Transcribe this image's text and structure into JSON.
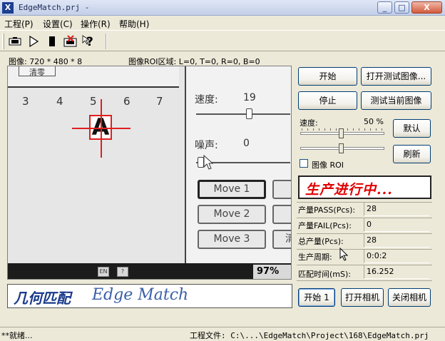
{
  "window": {
    "title": "EdgeMatch.prj -",
    "app_icon": "X",
    "minimize": "_",
    "maximize": "□",
    "close": "X"
  },
  "menu": [
    {
      "label": "工程(P)"
    },
    {
      "label": "设置(C)"
    },
    {
      "label": "操作(R)"
    },
    {
      "label": "帮助(H)"
    }
  ],
  "toolbar": {
    "icons": [
      "camera-icon",
      "play-icon",
      "stop-icon",
      "camera-off-icon",
      "help-icon"
    ]
  },
  "image_info": {
    "size": "图像: 720 * 480 * 8",
    "roi": "图像ROI区域: L=0, T=0, R=0, B=0"
  },
  "view": {
    "tab": "清零",
    "numbers": [
      "3",
      "4",
      "5",
      "6",
      "7"
    ],
    "speed_label": "速度:",
    "speed_value": "19",
    "noise_label": "噪声:",
    "noise_value": "0",
    "move_buttons": [
      "Move 1",
      "Move 2",
      "Move 3"
    ],
    "right_edge_char": "清",
    "bottom_icons": [
      "EN",
      "?"
    ],
    "bottom_right": "97%",
    "target_letter": "A"
  },
  "controls": {
    "start": "开始",
    "open_test_image": "打开测试图像...",
    "stop": "停止",
    "test_current_image": "测试当前图像",
    "speed_label": "速度:",
    "speed_value": "50 %",
    "speed_level_percent": 50,
    "default": "默认",
    "refresh": "刷新",
    "image_roi": "图像 ROI",
    "image_roi_checked": false
  },
  "status_banner": "生产进行中...",
  "stats": [
    {
      "label": "产量PASS(Pcs):",
      "value": "28"
    },
    {
      "label": "产量FAIL(Pcs):",
      "value": "0"
    },
    {
      "label": "总产量(Pcs):",
      "value": "28"
    },
    {
      "label": "生产周期:",
      "value": "0:0:2"
    },
    {
      "label": "匹配时间(mS):",
      "value": "16.252"
    }
  ],
  "logo": {
    "cn": "几何匹配",
    "en": "Edge Match"
  },
  "bottom_buttons": {
    "start1": "开始 1",
    "open_camera": "打开相机",
    "close_camera": "关闭相机"
  },
  "statusbar": {
    "left": "**就绪...",
    "project": "工程文件: C:\\...\\EdgeMatch\\Project\\168\\EdgeMatch.prj"
  }
}
